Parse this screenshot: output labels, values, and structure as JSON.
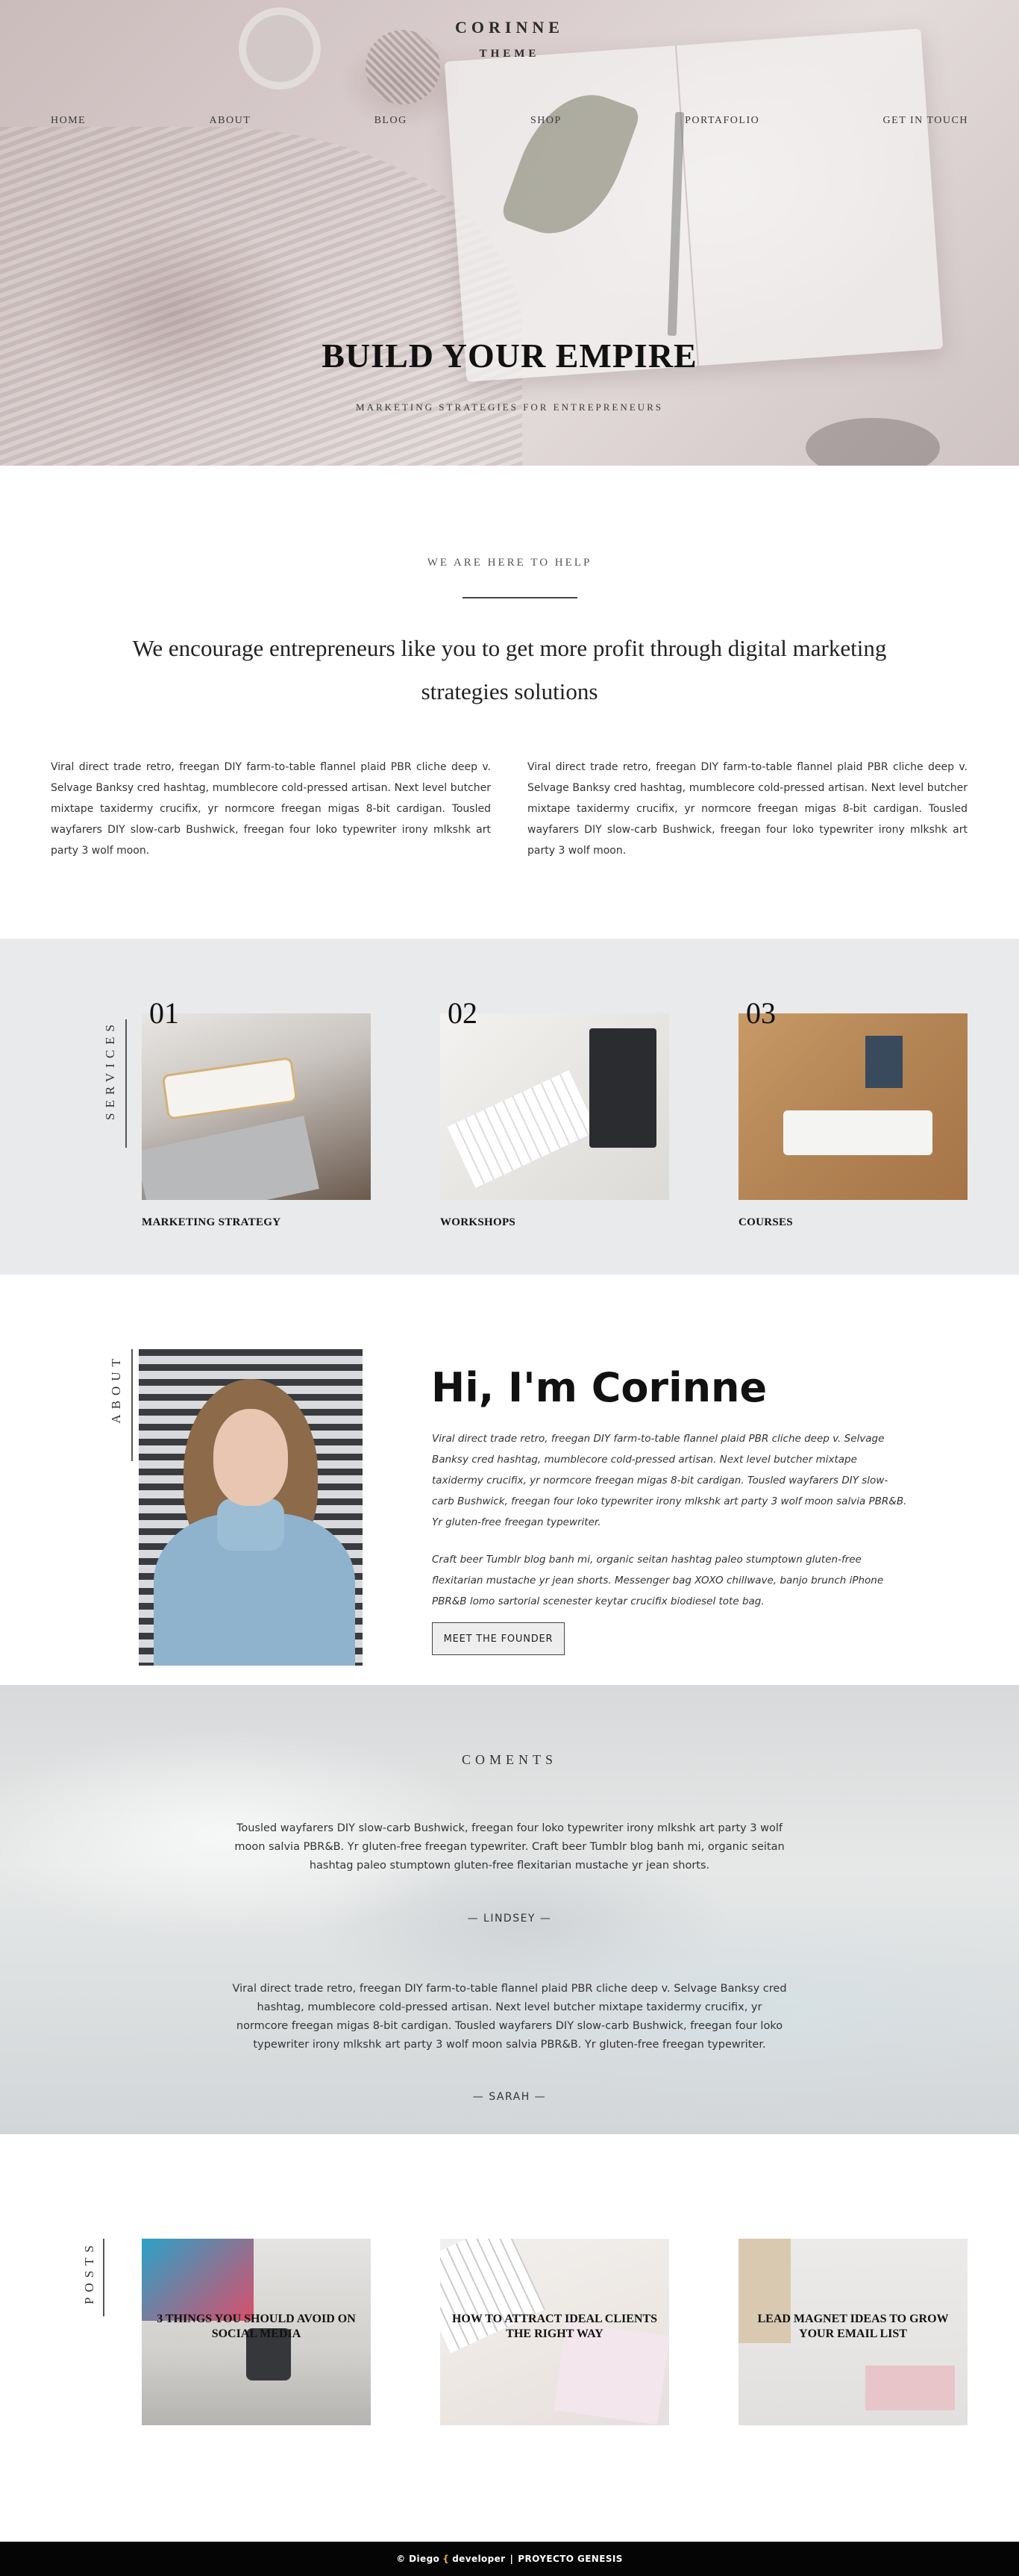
{
  "brand": {
    "line1": "CORINNE",
    "line2": "THEME"
  },
  "nav": [
    "HOME",
    "ABOUT",
    "BLOG",
    "SHOP",
    "PORTAFOLIO",
    "GET IN TOUCH"
  ],
  "hero": {
    "title": "BUILD YOUR EMPIRE",
    "subtitle": "MARKETING STRATEGIES FOR ENTREPRENEURS"
  },
  "help": {
    "eyebrow": "WE ARE HERE TO HELP",
    "lead": "We encourage entrepreneurs like you to get more profit through digital marketing strategies solutions",
    "col1": "Viral direct trade retro, freegan DIY farm-to-table flannel plaid PBR cliche deep v. Selvage Banksy cred hashtag, mumblecore cold-pressed artisan. Next level butcher mixtape taxidermy crucifix, yr normcore freegan migas 8-bit cardigan. Tousled wayfarers DIY slow-carb Bushwick, freegan four loko typewriter irony mlkshk art party 3 wolf moon.",
    "col2": "Viral direct trade retro, freegan DIY farm-to-table flannel plaid PBR cliche deep v. Selvage Banksy cred hashtag, mumblecore cold-pressed artisan. Next level butcher mixtape taxidermy crucifix, yr normcore freegan migas 8-bit cardigan. Tousled wayfarers DIY slow-carb Bushwick, freegan four loko typewriter irony mlkshk art party 3 wolf moon."
  },
  "services": {
    "label": "SERVICES",
    "items": [
      {
        "num": "01",
        "caption": "MARKETING STRATEGY"
      },
      {
        "num": "02",
        "caption": "WORKSHOPS"
      },
      {
        "num": "03",
        "caption": "COURSES"
      }
    ]
  },
  "about": {
    "label": "ABOUT",
    "heading": "Hi, I'm Corinne",
    "p1": "Viral direct trade retro, freegan DIY farm-to-table flannel plaid PBR cliche deep v. Selvage Banksy cred hashtag, mumblecore cold-pressed artisan. Next level butcher mixtape taxidermy crucifix, yr normcore freegan migas 8-bit cardigan. Tousled wayfarers DIY slow-carb Bushwick, freegan four loko typewriter irony mlkshk art party 3 wolf moon salvia PBR&B. Yr gluten-free freegan typewriter.",
    "p2": "Craft beer Tumblr blog banh mi, organic seitan hashtag paleo stumptown gluten-free flexitarian mustache yr jean shorts. Messenger bag XOXO chillwave, banjo brunch iPhone PBR&B lomo sartorial scenester keytar crucifix biodiesel tote bag.",
    "button": "MEET THE FOUNDER"
  },
  "comments": {
    "label": "COMENTS",
    "items": [
      {
        "text": "Tousled wayfarers DIY slow-carb Bushwick, freegan four loko typewriter irony mlkshk art party 3 wolf moon salvia PBR&B. Yr gluten-free freegan typewriter. Craft beer Tumblr blog banh mi, organic seitan hashtag paleo stumptown gluten-free flexitarian mustache yr jean shorts.",
        "author": "— LINDSEY —"
      },
      {
        "text": "Viral direct trade retro, freegan DIY farm-to-table flannel plaid PBR cliche deep v. Selvage Banksy cred hashtag, mumblecore cold-pressed artisan. Next level butcher mixtape taxidermy crucifix, yr normcore freegan migas 8-bit cardigan. Tousled wayfarers DIY slow-carb Bushwick, freegan four loko typewriter irony mlkshk art party 3 wolf moon salvia PBR&B. Yr gluten-free freegan typewriter.",
        "author": "— SARAH —"
      }
    ]
  },
  "posts": {
    "label": "POSTS",
    "items": [
      "3 THINGS YOU SHOULD AVOID ON SOCIAL MEDIA",
      "HOW TO ATTRACT IDEAL CLIENTS THE RIGHT WAY",
      "LEAD MAGNET IDEAS TO GROW YOUR EMAIL LIST"
    ]
  },
  "footer": {
    "copy": "© Diego",
    "brace": "{",
    "dev": "developer",
    "sep": "|",
    "project": "PROYECTO GENESIS"
  },
  "colors": {
    "accent": "#e8b32a",
    "footer_bg": "#050505",
    "services_bg": "#e9eaeb"
  }
}
